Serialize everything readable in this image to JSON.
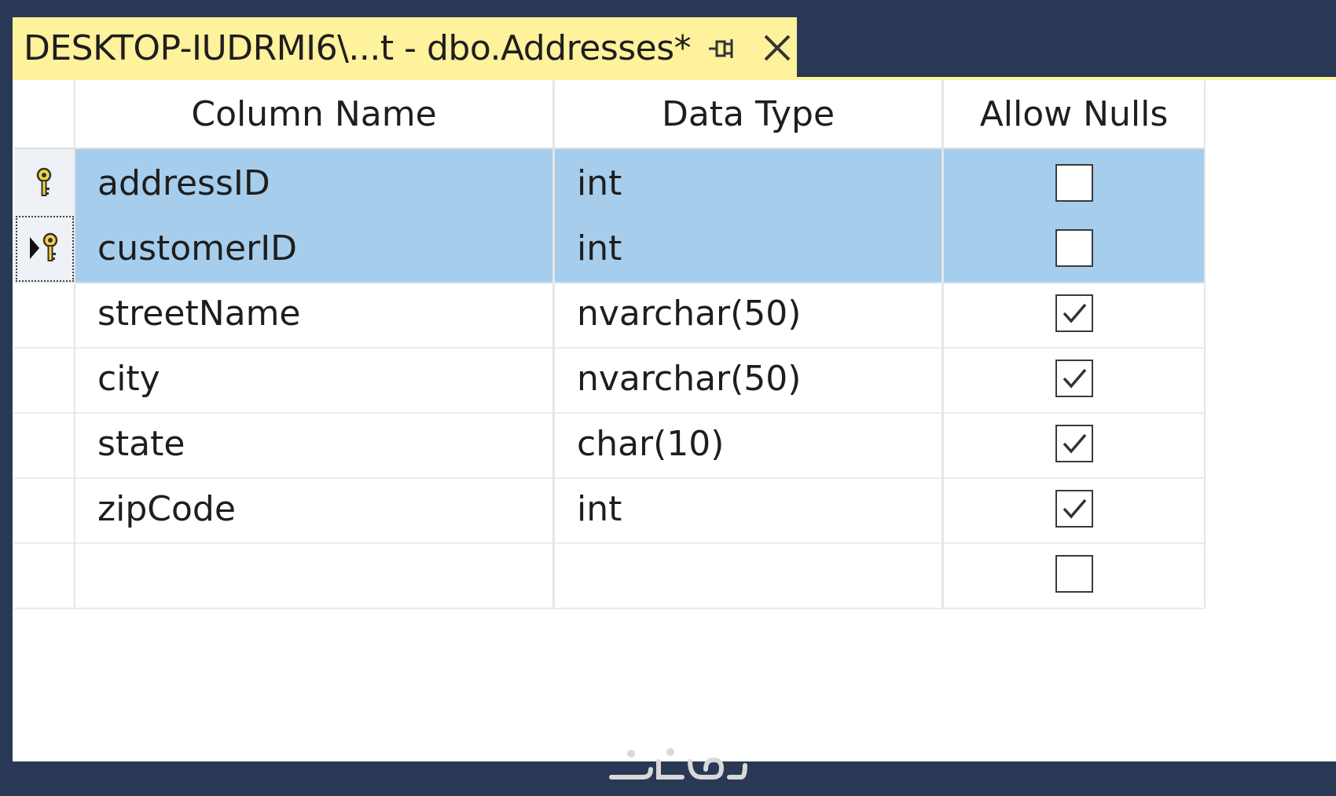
{
  "tab": {
    "title": "DESKTOP-IUDRMI6\\...t - dbo.Addresses*",
    "pin_icon": "pin-icon",
    "close_icon": "close-icon"
  },
  "columns": {
    "name": "Column Name",
    "type": "Data Type",
    "nulls": "Allow Nulls"
  },
  "rows": [
    {
      "name": "addressID",
      "type": "int",
      "allow_nulls": false,
      "primary_key": true,
      "selected": true,
      "current": false
    },
    {
      "name": "customerID",
      "type": "int",
      "allow_nulls": false,
      "primary_key": true,
      "selected": true,
      "current": true
    },
    {
      "name": "streetName",
      "type": "nvarchar(50)",
      "allow_nulls": true,
      "primary_key": false,
      "selected": false,
      "current": false
    },
    {
      "name": "city",
      "type": "nvarchar(50)",
      "allow_nulls": true,
      "primary_key": false,
      "selected": false,
      "current": false
    },
    {
      "name": "state",
      "type": "char(10)",
      "allow_nulls": true,
      "primary_key": false,
      "selected": false,
      "current": false
    },
    {
      "name": "zipCode",
      "type": "int",
      "allow_nulls": true,
      "primary_key": false,
      "selected": false,
      "current": false
    },
    {
      "name": "",
      "type": "",
      "allow_nulls": false,
      "primary_key": false,
      "selected": false,
      "current": false
    }
  ],
  "colors": {
    "tab_background": "#fff29d",
    "frame": "#293955",
    "selection": "#a6cdec"
  },
  "watermark_logo": "khamsat-logo"
}
